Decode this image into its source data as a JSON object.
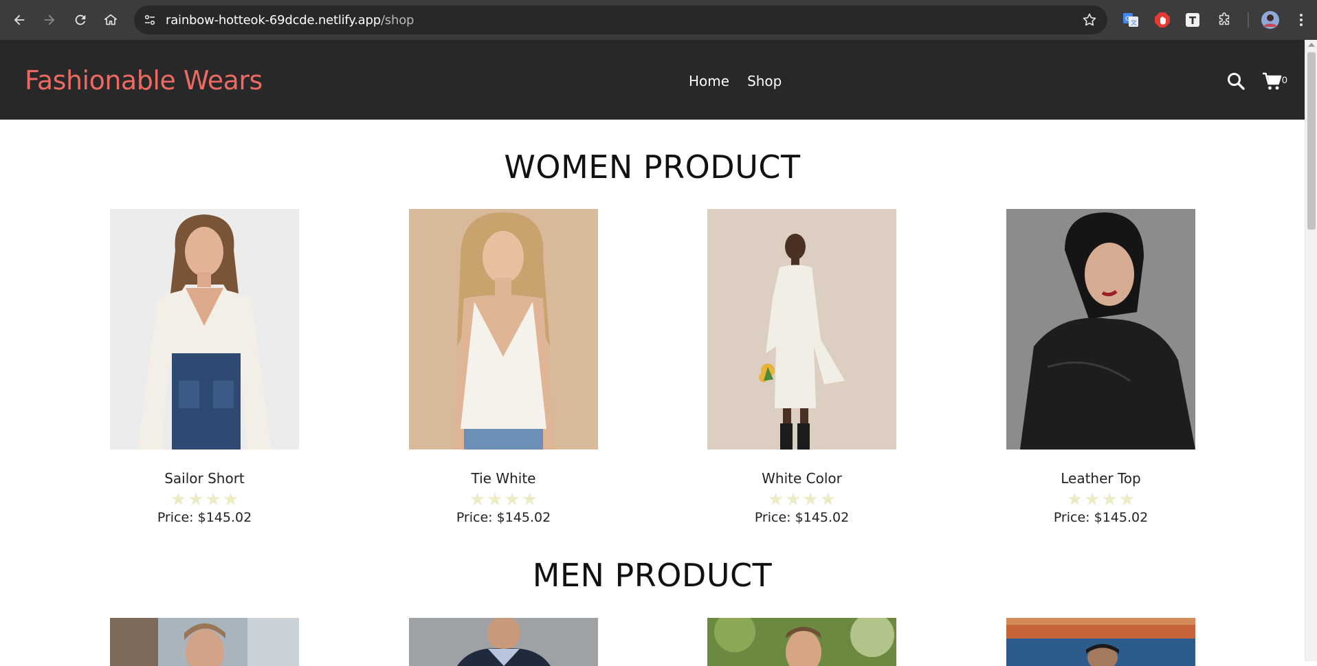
{
  "browser": {
    "url_host": "rainbow-hotteok-69dcde.netlify.app",
    "url_path": "/shop"
  },
  "header": {
    "brand": "Fashionable Wears",
    "nav": [
      {
        "label": "Home"
      },
      {
        "label": "Shop"
      }
    ],
    "cart_count": "0"
  },
  "women": {
    "title": "WOMEN PRODUCT",
    "products": [
      {
        "name": "Sailor Short",
        "rating": 4,
        "price": "Price: $145.02"
      },
      {
        "name": "Tie White",
        "rating": 4,
        "price": "Price: $145.02"
      },
      {
        "name": "White Color",
        "rating": 4,
        "price": "Price: $145.02"
      },
      {
        "name": "Leather Top",
        "rating": 4,
        "price": "Price: $145.02"
      }
    ]
  },
  "men": {
    "title": "MEN PRODUCT"
  },
  "colors": {
    "brand": "#ed6a63",
    "header_bg": "#282828",
    "star": "#ecebc6"
  }
}
